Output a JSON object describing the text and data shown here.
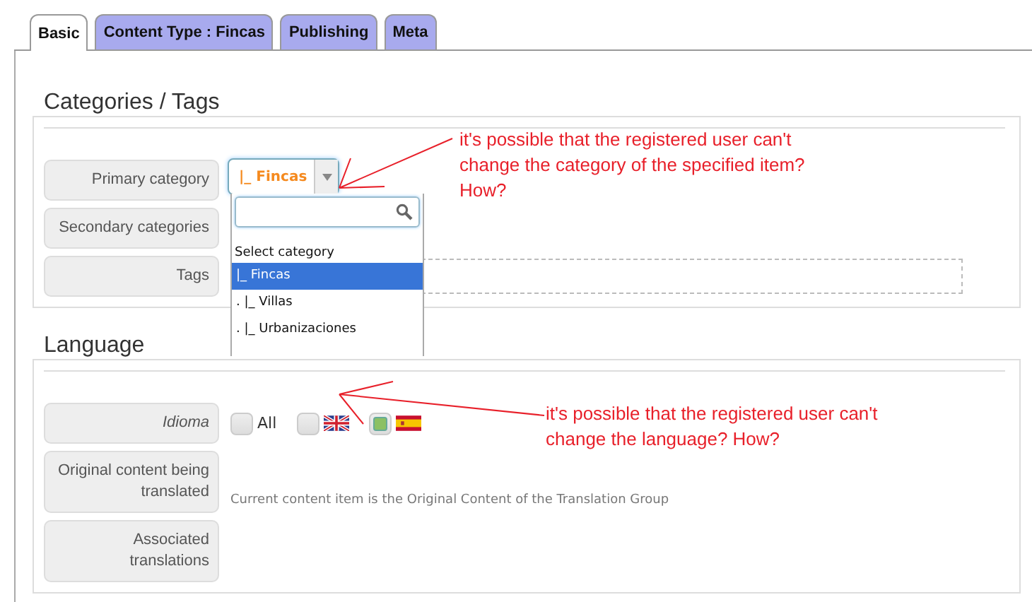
{
  "tabs": [
    {
      "label": "Basic",
      "selected": true
    },
    {
      "label": "Content Type : Fincas",
      "selected": false
    },
    {
      "label": "Publishing",
      "selected": false
    },
    {
      "label": "Meta",
      "selected": false
    }
  ],
  "categories": {
    "title": "Categories / Tags",
    "rows": [
      {
        "label": "Primary category",
        "italic": false,
        "kind": "select"
      },
      {
        "label": "Secondary categories",
        "italic": false,
        "kind": "none"
      },
      {
        "label": "Tags",
        "italic": false,
        "kind": "tags"
      }
    ],
    "select_value": "|_ Fincas",
    "dropdown": {
      "heading": "Select category",
      "options": [
        {
          "label": "|_ Fincas",
          "selected": true
        },
        {
          "label": ". |_ Villas",
          "selected": false
        },
        {
          "label": ". |_ Urbanizaciones",
          "selected": false
        }
      ]
    }
  },
  "language": {
    "title": "Language",
    "rows": [
      {
        "label": "Idioma",
        "italic": true
      },
      {
        "label": "Original content being translated",
        "italic": false
      },
      {
        "label": "Associated translations",
        "italic": false
      }
    ],
    "choices": [
      {
        "kind": "text",
        "label": "All",
        "checked": false
      },
      {
        "kind": "britain",
        "checked": false
      },
      {
        "kind": "spain",
        "checked": true
      }
    ],
    "note": "Current content item is the Original Content of the Translation Group"
  },
  "annotations": [
    {
      "lines": [
        "it's possible that the registered user can't",
        "change the category of the specified item?",
        "How?"
      ]
    },
    {
      "lines": [
        "it's possible that the registered user can't",
        "change the language? How?"
      ]
    }
  ]
}
